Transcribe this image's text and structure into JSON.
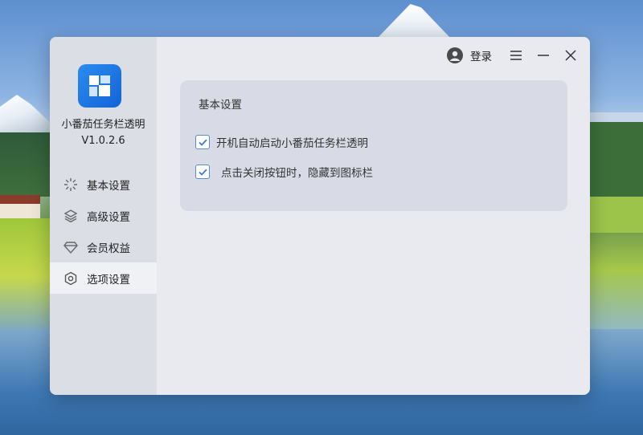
{
  "app": {
    "name": "小番茄任务栏透明",
    "version": "V1.0.2.6",
    "brand_color": "#1f78e6"
  },
  "header": {
    "login_label": "登录",
    "icons": [
      "user-avatar-icon",
      "menu-icon",
      "minimize-icon",
      "close-icon"
    ]
  },
  "sidebar": {
    "items": [
      {
        "label": "基本设置",
        "icon": "sparkle-icon",
        "active": false
      },
      {
        "label": "高级设置",
        "icon": "layers-icon",
        "active": false
      },
      {
        "label": "会员权益",
        "icon": "diamond-icon",
        "active": false
      },
      {
        "label": "选项设置",
        "icon": "hexagon-icon",
        "active": true
      }
    ]
  },
  "panel": {
    "title": "基本设置",
    "options": [
      {
        "label": "开机自动启动小番茄任务栏透明",
        "checked": true
      },
      {
        "label": "点击关闭按钮时，隐藏到图标栏",
        "checked": true
      }
    ]
  }
}
